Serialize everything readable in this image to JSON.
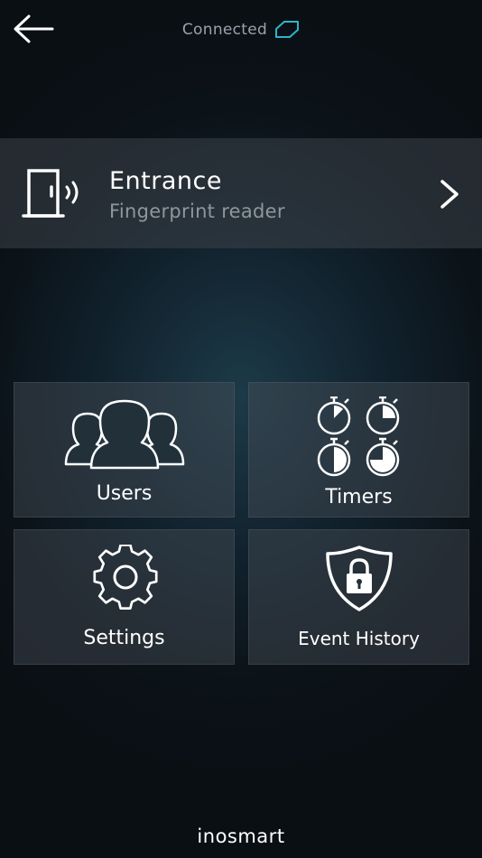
{
  "topbar": {
    "back_icon": "back-arrow-icon",
    "status_text": "Connected",
    "status_icon": "link-icon",
    "status_icon_color": "#2bb6c9"
  },
  "device": {
    "name": "Entrance",
    "type": "Fingerprint reader",
    "icon": "door-signal-icon",
    "chevron_icon": "chevron-right-icon"
  },
  "menu": [
    {
      "id": "users",
      "label": "Users",
      "icon": "users-icon"
    },
    {
      "id": "timers",
      "label": "Timers",
      "icon": "timers-icon"
    },
    {
      "id": "settings",
      "label": "Settings",
      "icon": "gear-icon"
    },
    {
      "id": "event-history",
      "label": "Event History",
      "icon": "shield-lock-icon"
    }
  ],
  "footer": {
    "brand": "inosmart"
  },
  "colors": {
    "accent": "#2bb6c9",
    "text": "#ffffff",
    "muted": "#8e979c"
  }
}
